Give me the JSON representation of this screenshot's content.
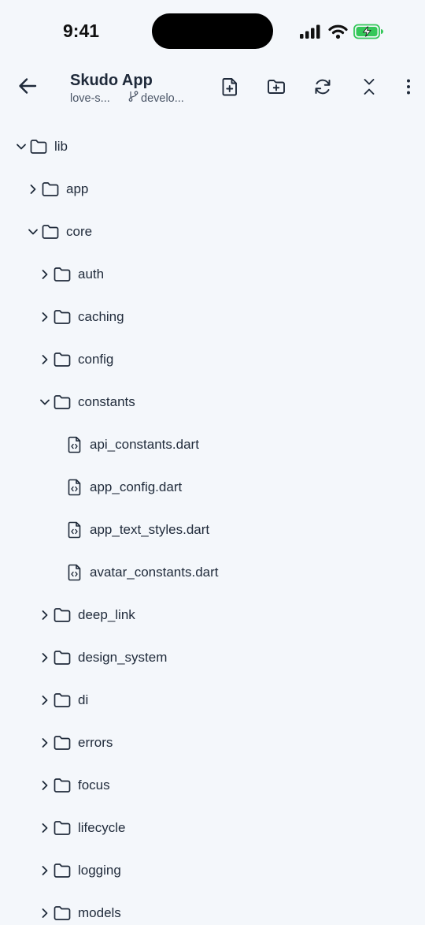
{
  "status_bar": {
    "time": "9:41"
  },
  "header": {
    "title": "Skudo App",
    "repo": "love-s...",
    "branch": "develo..."
  },
  "tree": [
    {
      "name": "lib",
      "type": "folder",
      "expanded": true,
      "depth": 0
    },
    {
      "name": "app",
      "type": "folder",
      "expanded": false,
      "depth": 1
    },
    {
      "name": "core",
      "type": "folder",
      "expanded": true,
      "depth": 1
    },
    {
      "name": "auth",
      "type": "folder",
      "expanded": false,
      "depth": 2
    },
    {
      "name": "caching",
      "type": "folder",
      "expanded": false,
      "depth": 2
    },
    {
      "name": "config",
      "type": "folder",
      "expanded": false,
      "depth": 2
    },
    {
      "name": "constants",
      "type": "folder",
      "expanded": true,
      "depth": 2
    },
    {
      "name": "api_constants.dart",
      "type": "file",
      "depth": 3
    },
    {
      "name": "app_config.dart",
      "type": "file",
      "depth": 3
    },
    {
      "name": "app_text_styles.dart",
      "type": "file",
      "depth": 3
    },
    {
      "name": "avatar_constants.dart",
      "type": "file",
      "depth": 3
    },
    {
      "name": "deep_link",
      "type": "folder",
      "expanded": false,
      "depth": 2
    },
    {
      "name": "design_system",
      "type": "folder",
      "expanded": false,
      "depth": 2
    },
    {
      "name": "di",
      "type": "folder",
      "expanded": false,
      "depth": 2
    },
    {
      "name": "errors",
      "type": "folder",
      "expanded": false,
      "depth": 2
    },
    {
      "name": "focus",
      "type": "folder",
      "expanded": false,
      "depth": 2
    },
    {
      "name": "lifecycle",
      "type": "folder",
      "expanded": false,
      "depth": 2
    },
    {
      "name": "logging",
      "type": "folder",
      "expanded": false,
      "depth": 2
    },
    {
      "name": "models",
      "type": "folder",
      "expanded": false,
      "depth": 2
    }
  ],
  "colors": {
    "background": "#f4f7fb",
    "text": "#1f2a3a",
    "icon": "#1f2a3a",
    "battery_fill": "#34c759"
  },
  "icons": {
    "back": "arrow-left-icon",
    "new_file": "new-file-icon",
    "new_folder": "new-folder-icon",
    "refresh": "refresh-icon",
    "collapse_all": "collapse-all-icon",
    "more": "more-vertical-icon",
    "branch": "git-branch-icon",
    "folder": "folder-icon",
    "file": "dart-file-icon"
  }
}
